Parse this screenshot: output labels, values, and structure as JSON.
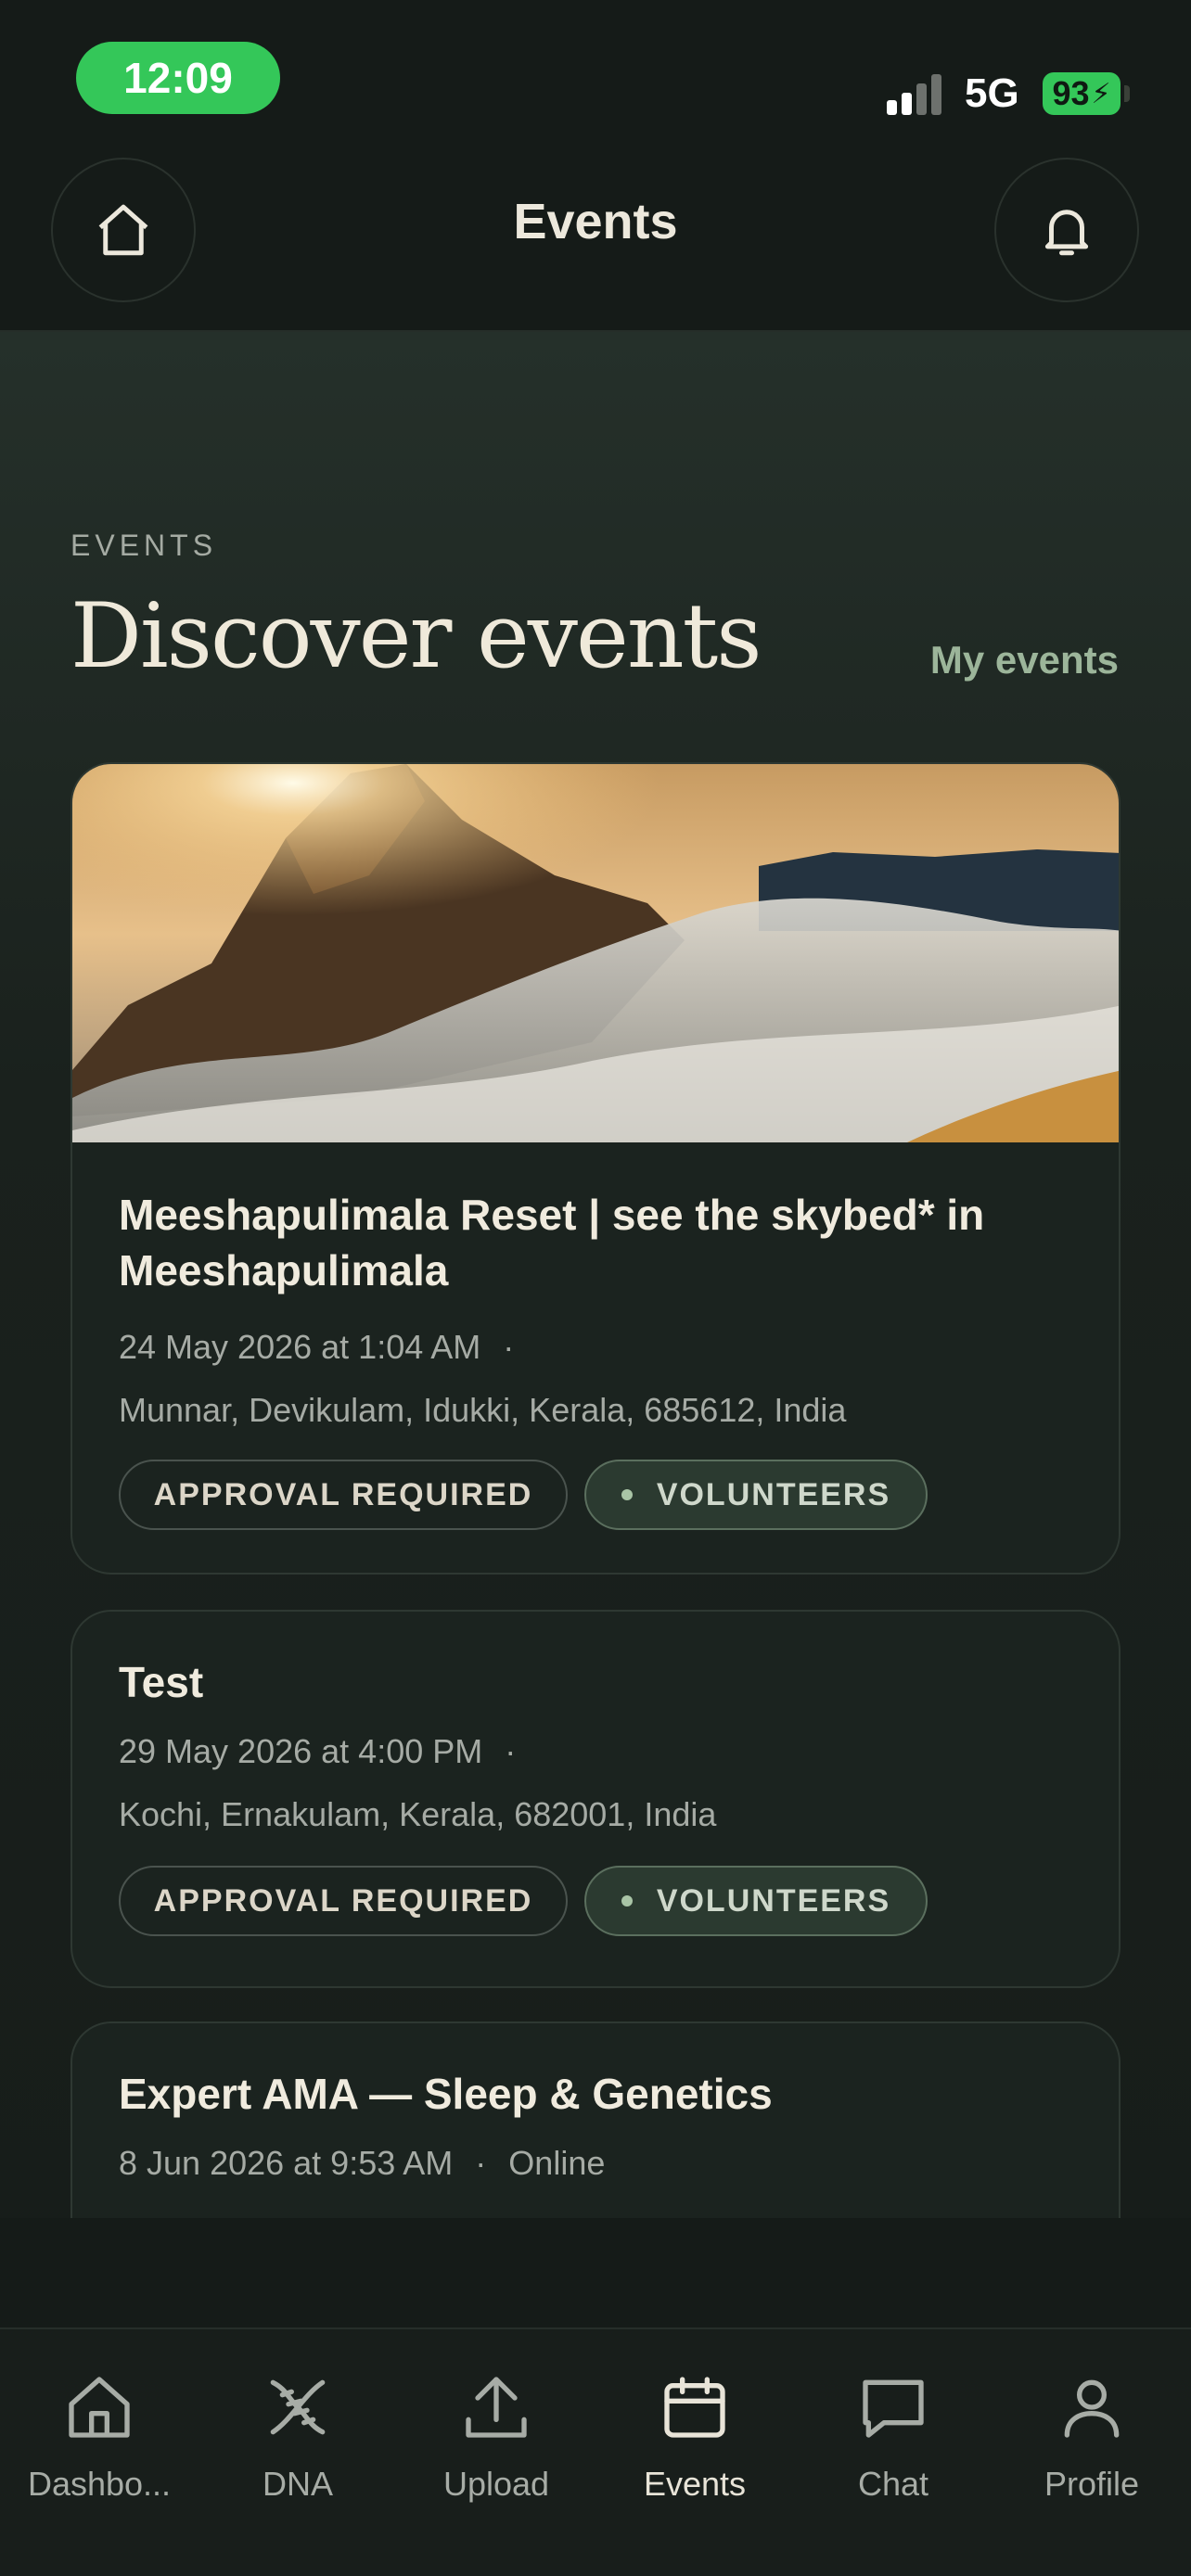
{
  "status_bar": {
    "time": "12:09",
    "network": "5G",
    "battery": "93"
  },
  "header": {
    "title": "Events",
    "home_icon": "home-icon",
    "bell_icon": "bell-icon"
  },
  "section": {
    "eyebrow": "EVENTS",
    "title": "Discover events",
    "my_events_link": "My events"
  },
  "events": [
    {
      "title": "Meeshapulimala Reset | see the skybed* in Meeshapulimala",
      "datetime": "24 May 2026 at 1:04 AM",
      "location": "Munnar, Devikulam, Idukki, Kerala, 685612, India",
      "tags": [
        "APPROVAL REQUIRED",
        "VOLUNTEERS"
      ],
      "has_image": true
    },
    {
      "title": "Test",
      "datetime": "29 May 2026 at 4:00 PM",
      "location": "Kochi, Ernakulam, Kerala, 682001, India",
      "tags": [
        "APPROVAL REQUIRED",
        "VOLUNTEERS"
      ]
    },
    {
      "title": "Expert AMA — Sleep & Genetics",
      "datetime": "8 Jun 2026 at 9:53 AM",
      "location": "Online"
    }
  ],
  "meta_separator": "·",
  "bottom_nav": [
    {
      "label": "Dashbo...",
      "icon": "home-icon"
    },
    {
      "label": "DNA",
      "icon": "dna-icon"
    },
    {
      "label": "Upload",
      "icon": "upload-icon"
    },
    {
      "label": "Events",
      "icon": "calendar-icon",
      "active": true
    },
    {
      "label": "Chat",
      "icon": "chat-icon"
    },
    {
      "label": "Profile",
      "icon": "profile-icon"
    }
  ],
  "colors": {
    "accent_green": "#34c759",
    "background": "#151b18",
    "link": "#9cb59a"
  }
}
